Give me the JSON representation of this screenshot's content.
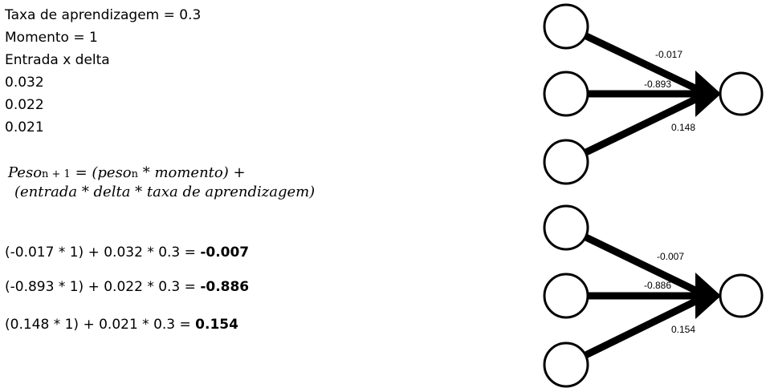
{
  "params": {
    "learning_rate": "Taxa de aprendizagem = 0.3",
    "momentum": "Momento = 1",
    "input_delta_header": "Entrada x delta",
    "input_delta_values": [
      "0.032",
      "0.022",
      "0.021"
    ]
  },
  "formula": {
    "peso_a": "Peso",
    "sub_n1": "n + 1",
    "eq_open": " = (peso",
    "sub_n": "n",
    "momentum_part": " * momento) +",
    "line2": "(entrada  * delta  * taxa de aprendizagem)"
  },
  "calculations": [
    {
      "expr": "(-0.017 * 1) + 0.032 * 0.3 = ",
      "result": "-0.007"
    },
    {
      "expr": "(-0.893 * 1) + 0.022 * 0.3 = ",
      "result": "-0.886"
    },
    {
      "expr": "(0.148 * 1) + 0.021 * 0.3 = ",
      "result": "0.154"
    }
  ],
  "network_top": {
    "weights": [
      "-0.017",
      "-0.893",
      "0.148"
    ]
  },
  "network_bottom": {
    "weights": [
      "-0.007",
      "-0.886",
      "0.154"
    ]
  }
}
